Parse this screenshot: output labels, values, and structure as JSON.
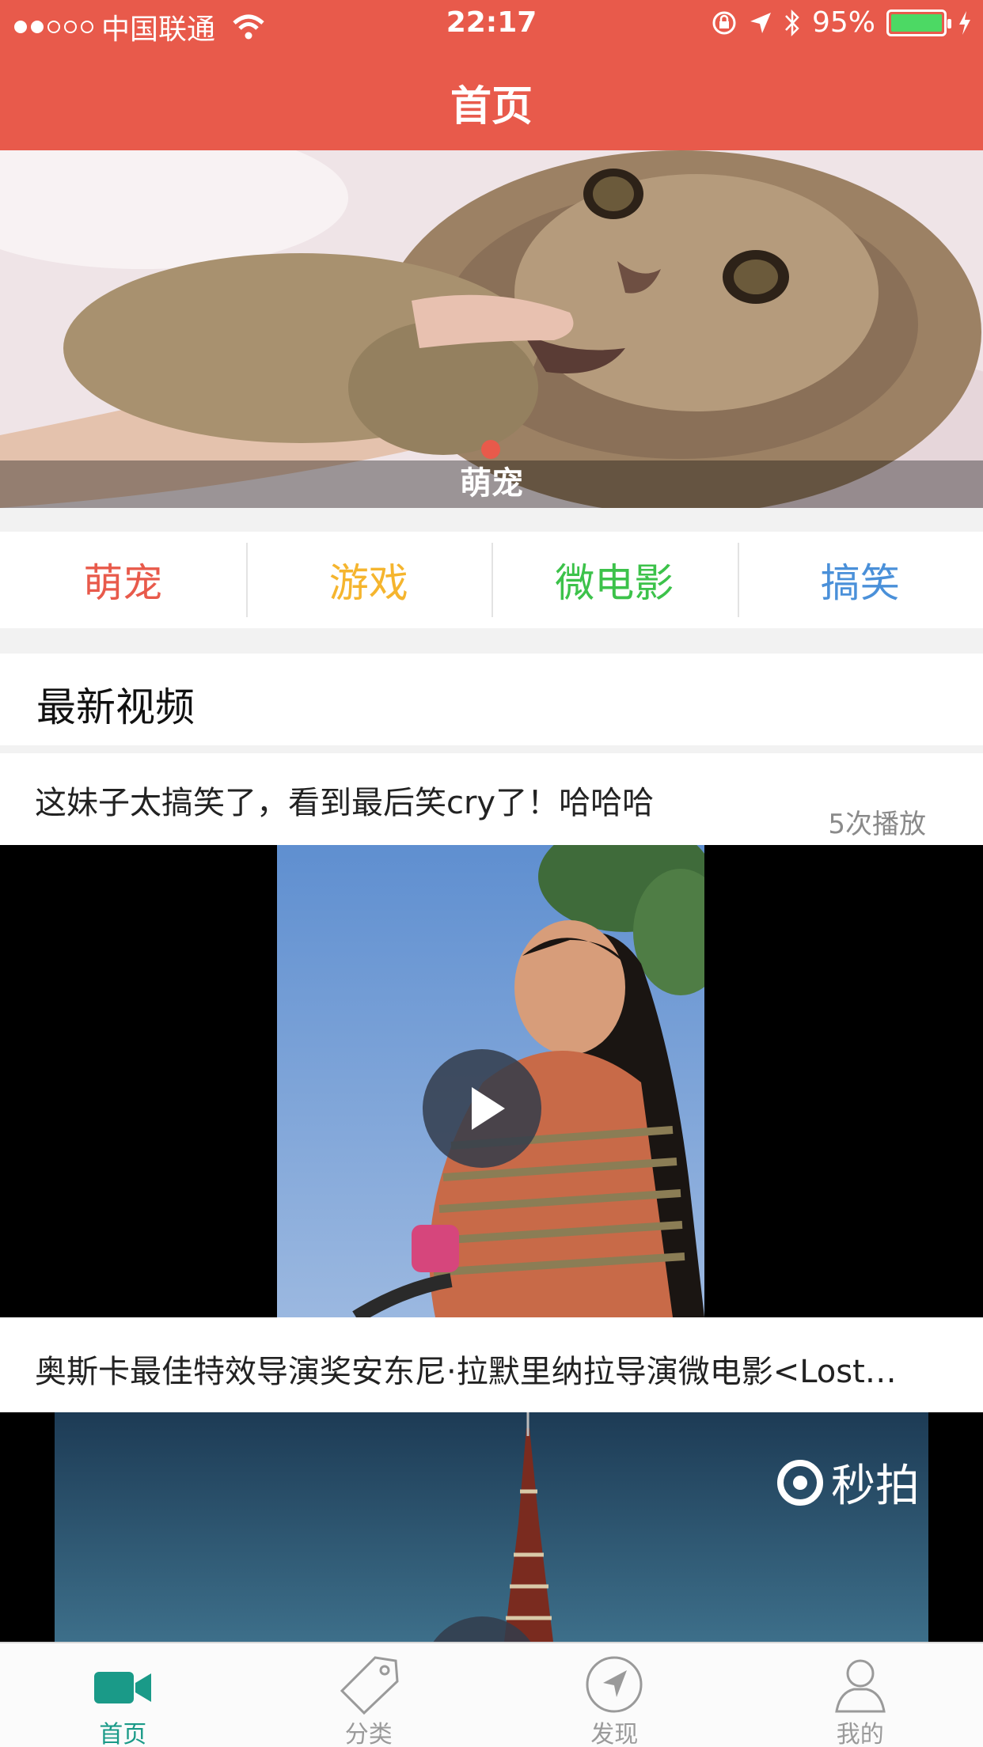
{
  "status_bar": {
    "carrier": "中国联通",
    "time": "22:17",
    "battery": "95%",
    "battery_level": 0.95
  },
  "nav": {
    "title": "首页"
  },
  "banner": {
    "caption": "萌宠"
  },
  "categories": [
    {
      "label": "萌宠",
      "color": "#e85a4b"
    },
    {
      "label": "游戏",
      "color": "#f5b52e"
    },
    {
      "label": "微电影",
      "color": "#3cc24a"
    },
    {
      "label": "搞笑",
      "color": "#4a90d9"
    }
  ],
  "section": {
    "title": "最新视频"
  },
  "videos": [
    {
      "title": "这妹子太搞笑了，看到最后笑cry了！哈哈哈",
      "plays": "5次播放"
    },
    {
      "title": "奥斯卡最佳特效导演奖安东尼·拉默里纳拉导演微电影<Lost…",
      "watermark": "秒拍"
    }
  ],
  "tabbar": {
    "items": [
      {
        "label": "首页",
        "icon": "video-camera-icon",
        "active": true
      },
      {
        "label": "分类",
        "icon": "tag-icon",
        "active": false
      },
      {
        "label": "发现",
        "icon": "compass-icon",
        "active": false
      },
      {
        "label": "我的",
        "icon": "person-icon",
        "active": false
      }
    ],
    "active_color": "#1a9a88"
  }
}
